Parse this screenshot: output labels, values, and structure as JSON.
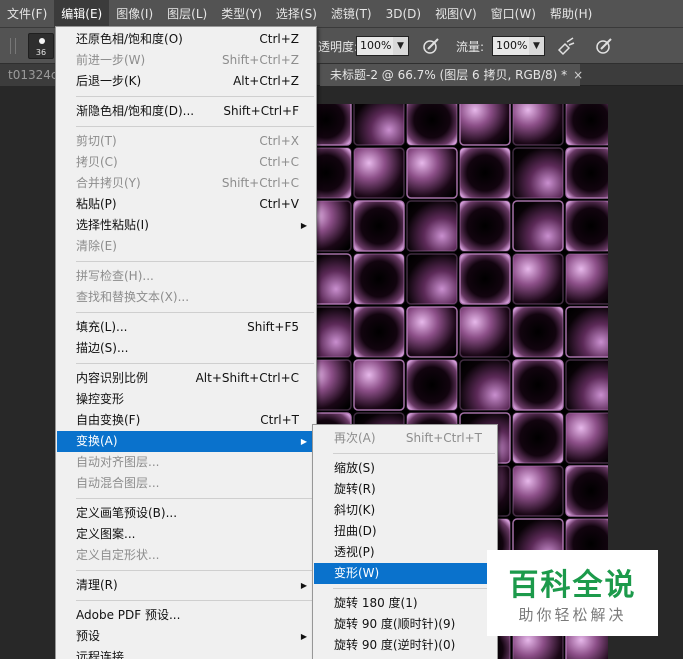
{
  "menubar": [
    {
      "label": "文件(F)",
      "active": false
    },
    {
      "label": "编辑(E)",
      "active": true
    },
    {
      "label": "图像(I)",
      "active": false
    },
    {
      "label": "图层(L)",
      "active": false
    },
    {
      "label": "类型(Y)",
      "active": false
    },
    {
      "label": "选择(S)",
      "active": false
    },
    {
      "label": "滤镜(T)",
      "active": false
    },
    {
      "label": "3D(D)",
      "active": false
    },
    {
      "label": "视图(V)",
      "active": false
    },
    {
      "label": "窗口(W)",
      "active": false
    },
    {
      "label": "帮助(H)",
      "active": false
    }
  ],
  "options": {
    "brush_size": "36",
    "opacity_label": "透明度:",
    "opacity_value": "100%",
    "flow_label": "流量:",
    "flow_value": "100%"
  },
  "tabs": {
    "inactive_label": "t01324c",
    "active_label": "未标题-2 @ 66.7% (图层 6 拷贝, RGB/8) *",
    "close_glyph": "×"
  },
  "edit_menu": [
    {
      "label": "还原色相/饱和度(O)",
      "shortcut": "Ctrl+Z",
      "state": "normal"
    },
    {
      "label": "前进一步(W)",
      "shortcut": "Shift+Ctrl+Z",
      "state": "disabled"
    },
    {
      "label": "后退一步(K)",
      "shortcut": "Alt+Ctrl+Z",
      "state": "normal"
    },
    {
      "sep": true
    },
    {
      "label": "渐隐色相/饱和度(D)...",
      "shortcut": "Shift+Ctrl+F",
      "state": "normal"
    },
    {
      "sep": true
    },
    {
      "label": "剪切(T)",
      "shortcut": "Ctrl+X",
      "state": "disabled"
    },
    {
      "label": "拷贝(C)",
      "shortcut": "Ctrl+C",
      "state": "disabled"
    },
    {
      "label": "合并拷贝(Y)",
      "shortcut": "Shift+Ctrl+C",
      "state": "disabled"
    },
    {
      "label": "粘贴(P)",
      "shortcut": "Ctrl+V",
      "state": "normal"
    },
    {
      "label": "选择性粘贴(I)",
      "shortcut": "",
      "state": "normal",
      "submenu": true
    },
    {
      "label": "清除(E)",
      "shortcut": "",
      "state": "disabled"
    },
    {
      "sep": true
    },
    {
      "label": "拼写检查(H)...",
      "shortcut": "",
      "state": "disabled"
    },
    {
      "label": "查找和替换文本(X)...",
      "shortcut": "",
      "state": "disabled"
    },
    {
      "sep": true
    },
    {
      "label": "填充(L)...",
      "shortcut": "Shift+F5",
      "state": "normal"
    },
    {
      "label": "描边(S)...",
      "shortcut": "",
      "state": "normal"
    },
    {
      "sep": true
    },
    {
      "label": "内容识别比例",
      "shortcut": "Alt+Shift+Ctrl+C",
      "state": "normal"
    },
    {
      "label": "操控变形",
      "shortcut": "",
      "state": "normal"
    },
    {
      "label": "自由变换(F)",
      "shortcut": "Ctrl+T",
      "state": "normal"
    },
    {
      "label": "变换(A)",
      "shortcut": "",
      "state": "selected",
      "submenu": true
    },
    {
      "label": "自动对齐图层...",
      "shortcut": "",
      "state": "disabled"
    },
    {
      "label": "自动混合图层...",
      "shortcut": "",
      "state": "disabled"
    },
    {
      "sep": true
    },
    {
      "label": "定义画笔预设(B)...",
      "shortcut": "",
      "state": "normal"
    },
    {
      "label": "定义图案...",
      "shortcut": "",
      "state": "normal"
    },
    {
      "label": "定义自定形状...",
      "shortcut": "",
      "state": "disabled"
    },
    {
      "sep": true
    },
    {
      "label": "清理(R)",
      "shortcut": "",
      "state": "normal",
      "submenu": true
    },
    {
      "sep": true
    },
    {
      "label": "Adobe PDF 预设...",
      "shortcut": "",
      "state": "normal"
    },
    {
      "label": "预设",
      "shortcut": "",
      "state": "normal",
      "submenu": true
    },
    {
      "label": "远程连接...",
      "shortcut": "",
      "state": "normal"
    }
  ],
  "transform_submenu": [
    {
      "label": "再次(A)",
      "shortcut": "Shift+Ctrl+T",
      "state": "disabled"
    },
    {
      "sep": true
    },
    {
      "label": "缩放(S)",
      "shortcut": "",
      "state": "normal"
    },
    {
      "label": "旋转(R)",
      "shortcut": "",
      "state": "normal"
    },
    {
      "label": "斜切(K)",
      "shortcut": "",
      "state": "normal"
    },
    {
      "label": "扭曲(D)",
      "shortcut": "",
      "state": "normal"
    },
    {
      "label": "透视(P)",
      "shortcut": "",
      "state": "normal"
    },
    {
      "label": "变形(W)",
      "shortcut": "",
      "state": "selected"
    },
    {
      "sep": true
    },
    {
      "label": "旋转 180 度(1)",
      "shortcut": "",
      "state": "normal"
    },
    {
      "label": "旋转 90 度(顺时针)(9)",
      "shortcut": "",
      "state": "normal"
    },
    {
      "label": "旋转 90 度(逆时针)(0)",
      "shortcut": "",
      "state": "normal"
    }
  ],
  "watermark": {
    "title": "百科全说",
    "subtitle": "助你轻松解决"
  },
  "colors": {
    "menu_highlight": "#0a72cc",
    "tile_glow": "#d7a0dc",
    "watermark_green": "#1c9a4b"
  }
}
